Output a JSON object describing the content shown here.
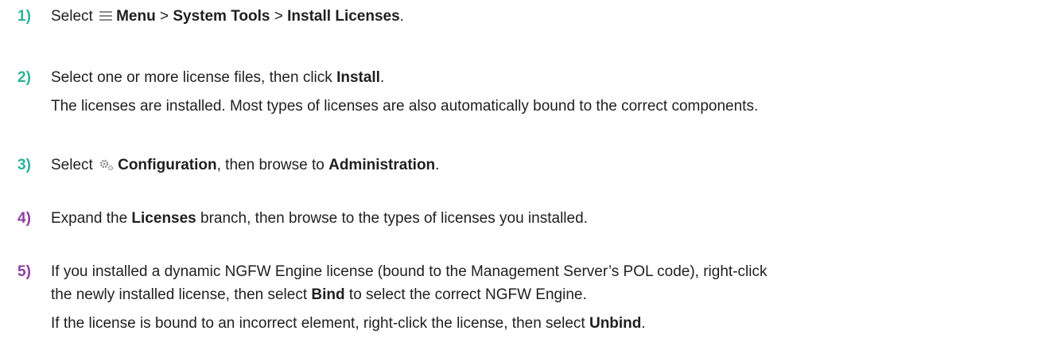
{
  "colors": {
    "step_numbers": [
      "#2bb39c",
      "#2bb39c",
      "#2bb39c",
      "#8e3fa0",
      "#8e3fa0"
    ],
    "text": "#1f1f1f",
    "icon": "#8a8a8a"
  },
  "steps": [
    {
      "number": "1)",
      "icons": [
        "menu-icon"
      ],
      "lines": [
        [
          {
            "t": "Select "
          },
          {
            "icon": "menu-icon"
          },
          {
            "t": "Menu",
            "b": true
          },
          {
            "t": " > "
          },
          {
            "t": "System Tools",
            "b": true
          },
          {
            "t": " > "
          },
          {
            "t": "Install Licenses",
            "b": true
          },
          {
            "t": "."
          }
        ]
      ]
    },
    {
      "number": "2)",
      "lines": [
        [
          {
            "t": "Select one or more license files, then click "
          },
          {
            "t": "Install",
            "b": true
          },
          {
            "t": "."
          }
        ],
        [
          {
            "t": "The licenses are installed. Most types of licenses are also automatically bound to the correct components."
          }
        ]
      ]
    },
    {
      "number": "3)",
      "icons": [
        "gears-icon"
      ],
      "lines": [
        [
          {
            "t": "Select "
          },
          {
            "icon": "gears-icon"
          },
          {
            "t": "Configuration",
            "b": true
          },
          {
            "t": ", then browse to "
          },
          {
            "t": "Administration",
            "b": true
          },
          {
            "t": "."
          }
        ]
      ]
    },
    {
      "number": "4)",
      "lines": [
        [
          {
            "t": "Expand the "
          },
          {
            "t": "Licenses",
            "b": true
          },
          {
            "t": " branch, then browse to the types of licenses you installed."
          }
        ]
      ]
    },
    {
      "number": "5)",
      "lines": [
        [
          {
            "t": "If you installed a dynamic NGFW Engine license (bound to the Management Server’s POL code), right-click"
          }
        ],
        [
          {
            "t": "the newly installed license, then select "
          },
          {
            "t": "Bind",
            "b": true
          },
          {
            "t": " to select the correct NGFW Engine."
          }
        ],
        [
          {
            "t": "If the license is bound to an incorrect element, right-click the license, then select "
          },
          {
            "t": "Unbind",
            "b": true
          },
          {
            "t": "."
          }
        ]
      ]
    }
  ]
}
